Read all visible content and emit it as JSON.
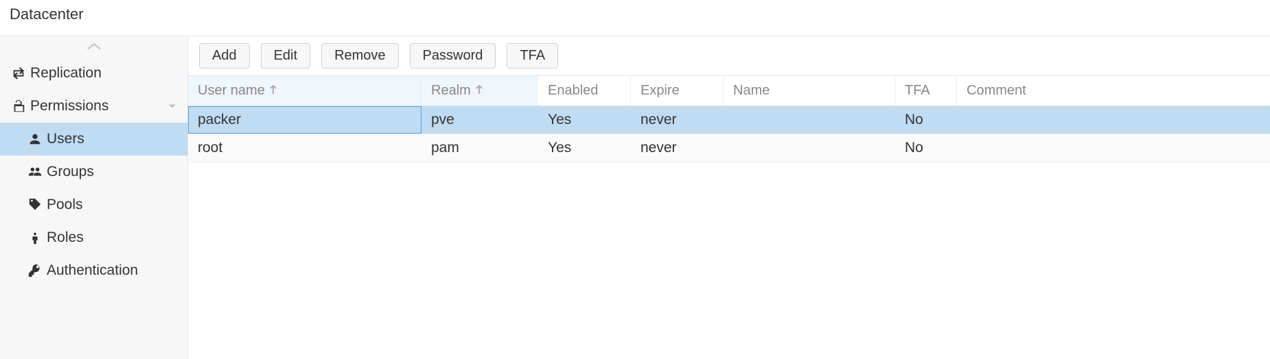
{
  "page_title": "Datacenter",
  "sidebar": {
    "items": [
      {
        "id": "replication",
        "label": "Replication",
        "icon": "retweet",
        "level": 0
      },
      {
        "id": "permissions",
        "label": "Permissions",
        "icon": "unlock",
        "level": 0,
        "expandable": true
      },
      {
        "id": "users",
        "label": "Users",
        "icon": "user",
        "level": 1,
        "active": true
      },
      {
        "id": "groups",
        "label": "Groups",
        "icon": "users",
        "level": 1
      },
      {
        "id": "pools",
        "label": "Pools",
        "icon": "tags",
        "level": 1
      },
      {
        "id": "roles",
        "label": "Roles",
        "icon": "male",
        "level": 1
      },
      {
        "id": "authentication",
        "label": "Authentication",
        "icon": "key",
        "level": 1
      }
    ]
  },
  "toolbar": {
    "add": "Add",
    "edit": "Edit",
    "remove": "Remove",
    "password": "Password",
    "tfa": "TFA"
  },
  "table": {
    "columns": {
      "username": "User name",
      "realm": "Realm",
      "enabled": "Enabled",
      "expire": "Expire",
      "name": "Name",
      "tfa": "TFA",
      "comment": "Comment"
    },
    "rows": [
      {
        "username": "packer",
        "realm": "pve",
        "enabled": "Yes",
        "expire": "never",
        "name": "",
        "tfa": "No",
        "comment": "",
        "selected": true
      },
      {
        "username": "root",
        "realm": "pam",
        "enabled": "Yes",
        "expire": "never",
        "name": "",
        "tfa": "No",
        "comment": ""
      }
    ]
  }
}
